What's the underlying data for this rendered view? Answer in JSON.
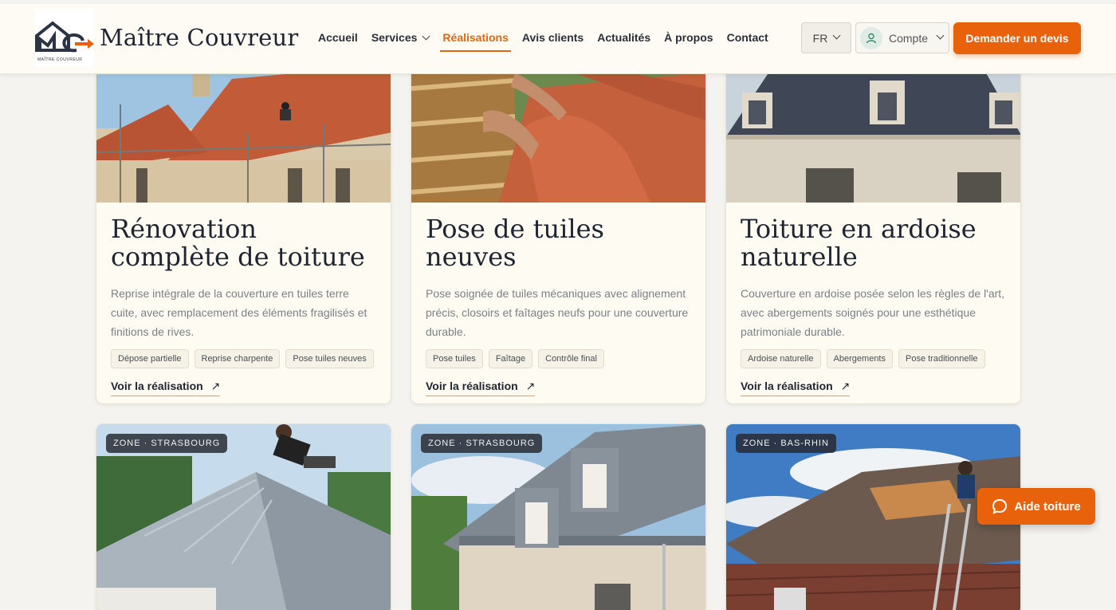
{
  "header": {
    "logo_caption": "MAÎTRE COUVREUR",
    "brand": "Maître Couvreur",
    "nav": [
      {
        "label": "Accueil",
        "active": false
      },
      {
        "label": "Services",
        "active": false,
        "dropdown": true
      },
      {
        "label": "Réalisations",
        "active": true
      },
      {
        "label": "Avis clients",
        "active": false
      },
      {
        "label": "Actualités",
        "active": false
      },
      {
        "label": "À propos",
        "active": false
      },
      {
        "label": "Contact",
        "active": false
      }
    ],
    "lang": "FR",
    "account": "Compte",
    "cta": "Demander un devis"
  },
  "projects": [
    {
      "title": "Rénovation complète de toiture",
      "description": "Reprise intégrale de la couverture en tuiles terre cuite, avec remplacement des éléments fragilisés et finitions de rives.",
      "tags": [
        "Dépose partielle",
        "Reprise charpente",
        "Pose tuiles neuves"
      ],
      "link": "Voir la réalisation"
    },
    {
      "title": "Pose de tuiles neuves",
      "description": "Pose soignée de tuiles mécaniques avec alignement précis, closoirs et faîtages neufs pour une couverture durable.",
      "tags": [
        "Pose tuiles",
        "Faîtage",
        "Contrôle final"
      ],
      "link": "Voir la réalisation"
    },
    {
      "title": "Toiture en ardoise naturelle",
      "description": "Couverture en ardoise posée selon les règles de l'art, avec abergements soignés pour une esthétique patrimoniale durable.",
      "tags": [
        "Ardoise naturelle",
        "Abergements",
        "Pose traditionnelle"
      ],
      "link": "Voir la réalisation"
    }
  ],
  "zones": [
    "ZONE · STRASBOURG",
    "ZONE · STRASBOURG",
    "ZONE · BAS-RHIN"
  ],
  "aide": "Aide toiture",
  "colors": {
    "accent": "#e8620c",
    "card_bg": "#fefcf2",
    "page_bg": "#f4f3ef"
  }
}
